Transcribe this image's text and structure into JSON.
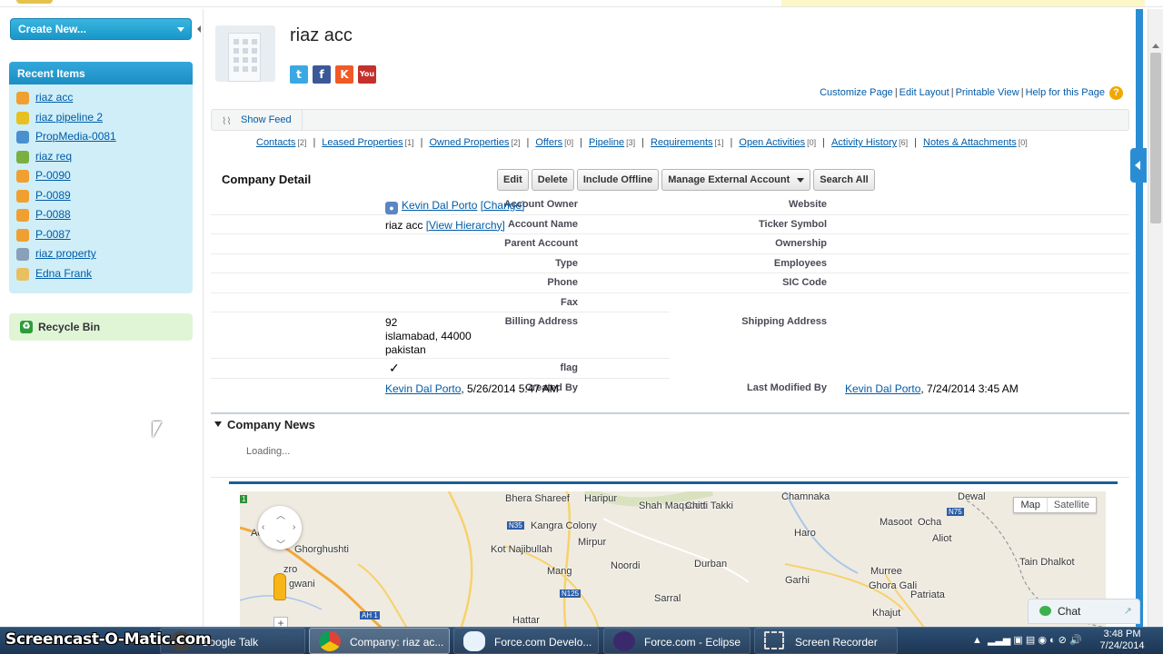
{
  "sidebar": {
    "create_new": "Create New...",
    "recent_title": "Recent Items",
    "recent_items": [
      {
        "label": "riaz acc",
        "color": "#f0a030"
      },
      {
        "label": "riaz pipeline 2",
        "color": "#e8c020"
      },
      {
        "label": "PropMedia-0081",
        "color": "#4a8fd0"
      },
      {
        "label": "riaz req",
        "color": "#7ab040"
      },
      {
        "label": "P-0090",
        "color": "#f0a030"
      },
      {
        "label": "P-0089",
        "color": "#f0a030"
      },
      {
        "label": "P-0088",
        "color": "#f0a030"
      },
      {
        "label": "P-0087",
        "color": "#f0a030"
      },
      {
        "label": "riaz property",
        "color": "#8aa0b8"
      },
      {
        "label": "Edna Frank",
        "color": "#e8c060"
      }
    ],
    "recycle_bin": "Recycle Bin"
  },
  "header": {
    "title": "riaz acc",
    "social": [
      "t",
      "f",
      "K",
      "You Tube"
    ],
    "help_links": [
      "Customize Page",
      "Edit Layout",
      "Printable View",
      "Help for this Page"
    ]
  },
  "feed": {
    "show_feed": "Show Feed"
  },
  "related": [
    {
      "label": "Contacts",
      "count": "[2]"
    },
    {
      "label": "Leased Properties",
      "count": "[1]"
    },
    {
      "label": "Owned Properties",
      "count": "[2]"
    },
    {
      "label": "Offers",
      "count": "[0]"
    },
    {
      "label": "Pipeline",
      "count": "[3]"
    },
    {
      "label": "Requirements",
      "count": "[1]"
    },
    {
      "label": "Open Activities",
      "count": "[0]"
    },
    {
      "label": "Activity History",
      "count": "[6]"
    },
    {
      "label": "Notes & Attachments",
      "count": "[0]"
    }
  ],
  "detail": {
    "heading": "Company Detail",
    "buttons": {
      "edit": "Edit",
      "delete": "Delete",
      "include_offline": "Include Offline",
      "manage_external": "Manage External Account",
      "search_all": "Search All"
    },
    "labels": {
      "account_owner": "Account Owner",
      "account_name": "Account Name",
      "parent_account": "Parent Account",
      "type": "Type",
      "phone": "Phone",
      "fax": "Fax",
      "billing_address": "Billing Address",
      "flag": "flag",
      "created_by": "Created By",
      "website": "Website",
      "ticker_symbol": "Ticker Symbol",
      "ownership": "Ownership",
      "employees": "Employees",
      "sic_code": "SIC Code",
      "shipping_address": "Shipping Address",
      "last_modified_by": "Last Modified By"
    },
    "values": {
      "owner_name": "Kevin Dal Porto",
      "owner_change": "[Change]",
      "account_name": "riaz acc",
      "view_hierarchy": "[View Hierarchy]",
      "billing_line1": "92",
      "billing_line2": "islamabad, 44000",
      "billing_line3": "pakistan",
      "flag": "✓",
      "created_by_name": "Kevin Dal Porto",
      "created_by_date": ", 5/26/2014 5:47 AM",
      "modified_by_name": "Kevin Dal Porto",
      "modified_by_date": ", 7/24/2014 3:45 AM"
    }
  },
  "news": {
    "heading": "Company News",
    "loading": "Loading..."
  },
  "map": {
    "type_map": "Map",
    "type_satellite": "Satellite",
    "places": [
      "Bhera Shareef",
      "Haripur",
      "Shah Maqsood",
      "Chitti Takki",
      "Dewal",
      "Masoot",
      "Ocha",
      "Aliot",
      "Ghorghushti",
      "Kangra Colony",
      "Kot Najibullah",
      "Mirpur",
      "Noordi",
      "Durban",
      "Garhi",
      "Murree",
      "Ghora Gali",
      "Tain Dhalkot",
      "Mang",
      "Sarral",
      "Patriata",
      "Hattar",
      "Khajut",
      "Haro",
      "Ac",
      "zro",
      "gwani",
      "Chamnaka"
    ],
    "route_labels": [
      "N35",
      "N125",
      "N75",
      "AH 1",
      "1"
    ]
  },
  "chat": {
    "label": "Chat"
  },
  "taskbar": {
    "watermark": "Screencast-O-Matic.com",
    "items": [
      "Google Talk",
      "Company: riaz ac...",
      "Force.com Develo...",
      "Force.com - Eclipse",
      "Screen Recorder"
    ],
    "time": "3:48 PM",
    "date": "7/24/2014"
  }
}
